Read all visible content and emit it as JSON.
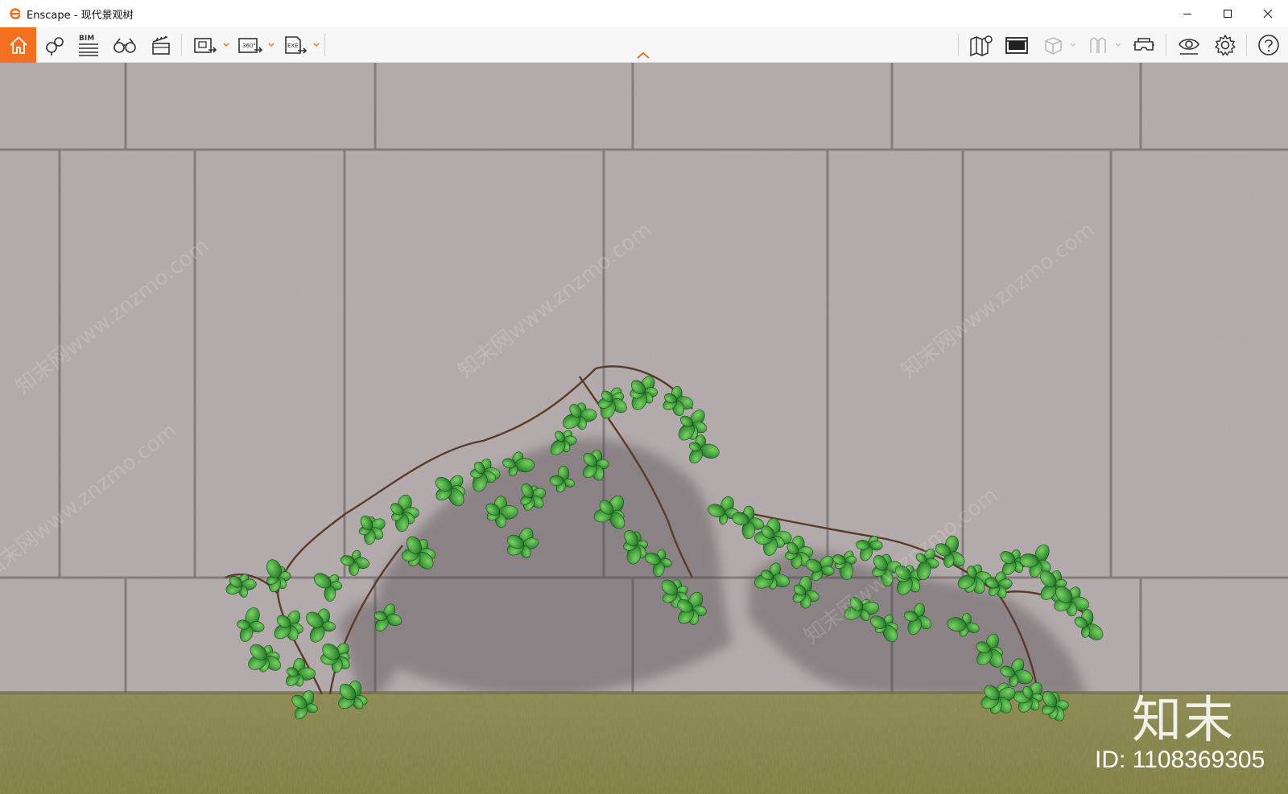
{
  "window": {
    "title": "Enscape - 现代景观树",
    "controls": [
      "minimize",
      "maximize",
      "close"
    ]
  },
  "toolbar": {
    "bim_label": "BIM",
    "icons": [
      "home-icon",
      "asset-library-icon",
      "bim-icon",
      "binoculars-icon",
      "video-editor-icon",
      "screenshot-export-icon",
      "panorama-360-export-icon",
      "exe-export-icon",
      "map-icon",
      "render-window-icon",
      "cube-icon",
      "sections-icon",
      "vr-headset-icon",
      "visual-settings-eye-icon",
      "settings-gear-icon",
      "help-icon"
    ],
    "panorama_label": "360°",
    "exe_label": "EXE",
    "accent_color": "#f37021"
  },
  "viewport": {
    "watermark_logo": "知末",
    "watermark_id": "ID: 1108369305",
    "watermark_pattern": "知末网www.znzmo.com"
  }
}
